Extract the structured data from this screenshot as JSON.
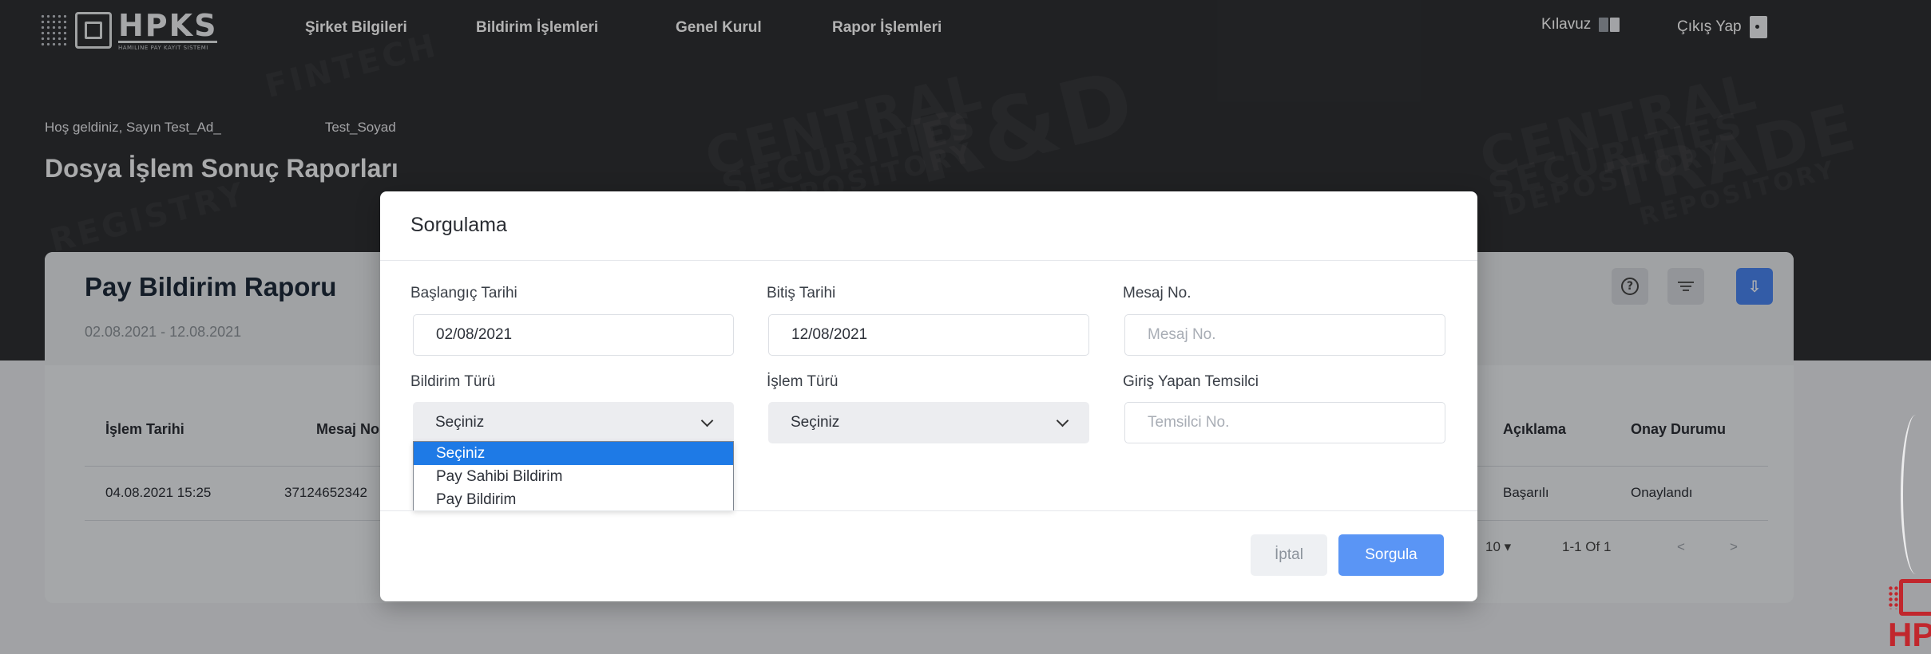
{
  "brand": {
    "logo_text": "HPKS",
    "logo_subtitle": "HAMILINE PAY KAYIT SISTEMI",
    "corner_logo_text": "HP",
    "watermark_words": [
      "CENTRAL",
      "SECURITIES",
      "DEPOSITORY",
      "TRADE",
      "FINTECH",
      "R&D",
      "REPOSITORY",
      "REGISTRY"
    ]
  },
  "nav": {
    "items": [
      "Şirket Bilgileri",
      "Bildirim İşlemleri",
      "Genel Kurul",
      "Rapor İşlemleri"
    ],
    "guide": "Kılavuz",
    "logout": "Çıkış Yap"
  },
  "header": {
    "welcome": "Hoş geldiniz, Sayın Test_Ad_",
    "surname": "Test_Soyad",
    "page_title": "Dosya İşlem Sonuç Raporları"
  },
  "card": {
    "title": "Pay Bildirim Raporu",
    "date_range": "02.08.2021 - 12.08.2021",
    "columns": [
      "İşlem Tarihi",
      "Mesaj No",
      "Açıklama",
      "Onay Durumu"
    ],
    "rows": [
      {
        "date": "04.08.2021 15:25",
        "message_no": "37124652342",
        "description": "Başarılı",
        "status": "Onaylandı"
      }
    ],
    "pager": {
      "page_size": "10",
      "range": "1-1 Of 1",
      "prev": "<",
      "next": ">"
    }
  },
  "modal": {
    "title": "Sorgulama",
    "fields": {
      "start_date": {
        "label": "Başlangıç Tarihi",
        "value": "02/08/2021"
      },
      "end_date": {
        "label": "Bitiş Tarihi",
        "value": "12/08/2021"
      },
      "message_no": {
        "label": "Mesaj No.",
        "placeholder": "Mesaj No."
      },
      "notification_type": {
        "label": "Bildirim Türü",
        "value": "Seçiniz"
      },
      "transaction_type": {
        "label": "İşlem Türü",
        "value": "Seçiniz"
      },
      "representative": {
        "label": "Giriş Yapan Temsilci",
        "placeholder": "Temsilci No."
      }
    },
    "dropdown_options": [
      "Seçiniz",
      "Pay Sahibi Bildirim",
      "Pay Bildirim"
    ],
    "cancel_label": "İptal",
    "submit_label": "Sorgula"
  },
  "colors": {
    "hero_bg": "#2f3033",
    "primary": "#5a95f5",
    "selected_option": "#1e7ae6",
    "brand_red": "#c1272d"
  }
}
